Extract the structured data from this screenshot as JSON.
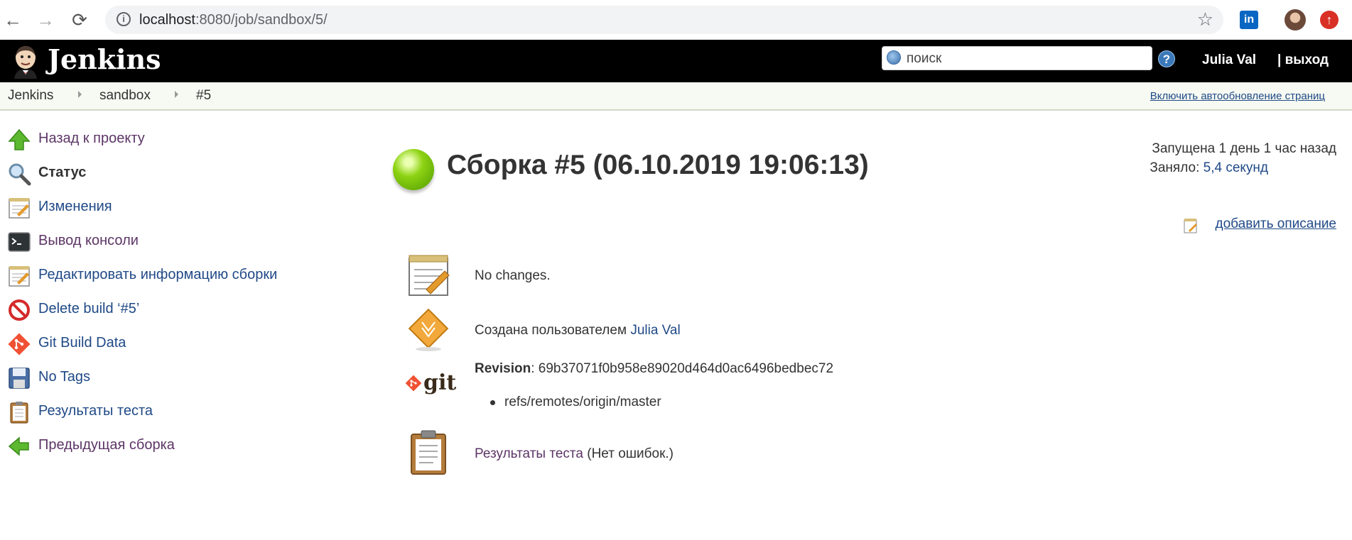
{
  "browser": {
    "url_host": "localhost",
    "url_path": ":8080/job/sandbox/5/",
    "ext_linkedin": "in"
  },
  "header": {
    "logo_text": "Jenkins",
    "search_placeholder": "поиск",
    "help": "?",
    "user": "Julia Val",
    "logout": "| выход"
  },
  "breadcrumbs": [
    "Jenkins",
    "sandbox",
    "#5"
  ],
  "auto_refresh": "Включить автообновление страниц",
  "sidebar": [
    {
      "label": "Назад к проекту",
      "icon": "up-arrow-icon"
    },
    {
      "label": "Статус",
      "icon": "search-icon"
    },
    {
      "label": "Изменения",
      "icon": "notepad-icon"
    },
    {
      "label": "Вывод консоли",
      "icon": "terminal-icon"
    },
    {
      "label": "Редактировать информацию сборки",
      "icon": "notepad-edit-icon"
    },
    {
      "label": "Delete build ‘#5’",
      "icon": "no-entry-icon"
    },
    {
      "label": "Git Build Data",
      "icon": "git-icon"
    },
    {
      "label": "No Tags",
      "icon": "save-icon"
    },
    {
      "label": "Результаты теста",
      "icon": "clipboard-icon"
    },
    {
      "label": "Предыдущая сборка",
      "icon": "left-arrow-icon"
    }
  ],
  "build": {
    "title": "Сборка #5 (06.10.2019 19:06:13)",
    "started": "Запущена 1 день 1 час назад",
    "duration_prefix": "Заняло: ",
    "duration": "5,4 секунд",
    "add_description": "добавить описание",
    "no_changes": "No changes.",
    "created_by_prefix": "Создана пользователем ",
    "created_by_user": "Julia Val",
    "revision_label": "Revision",
    "revision_value": ": 69b37071f0b958e89020d464d0ac6496bedbec72",
    "branch": "refs/remotes/origin/master",
    "test_results_link": "Результаты теста",
    "test_results_suffix": " (Нет ошибок.)",
    "git_icon_text": "git"
  },
  "colors": {
    "header_bg": "#000000",
    "link": "#204a87",
    "visited_link": "#5c3566",
    "breadcrumb_bg": "#f6faf2",
    "status_ball": "#8ed313"
  }
}
